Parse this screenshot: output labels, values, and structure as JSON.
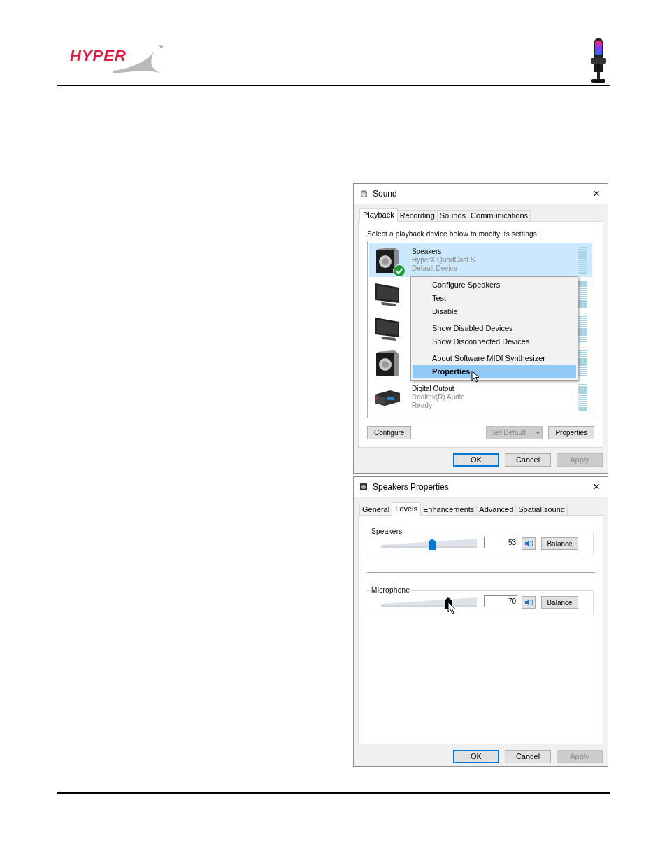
{
  "header": {
    "logo": {
      "text": "HYPER",
      "trademark": "™"
    }
  },
  "sound_window": {
    "title": "Sound",
    "close": "×",
    "tabs": [
      {
        "label": "Playback",
        "selected": true
      },
      {
        "label": "Recording",
        "selected": false
      },
      {
        "label": "Sounds",
        "selected": false
      },
      {
        "label": "Communications",
        "selected": false
      }
    ],
    "instruction": "Select a playback device below to modify its settings:",
    "devices": [
      {
        "kind": "speaker",
        "selected": true,
        "default": true,
        "name": "Speakers",
        "lines": [
          "HyperX QuadCast S",
          "Default Device"
        ]
      },
      {
        "kind": "monitor",
        "selected": false,
        "default": false
      },
      {
        "kind": "monitor",
        "selected": false,
        "default": false
      },
      {
        "kind": "speaker",
        "selected": false,
        "default": false
      },
      {
        "kind": "receiver",
        "selected": false,
        "default": false,
        "name": "Digital Output",
        "lines": [
          "Realtek(R) Audio",
          "Ready"
        ]
      }
    ],
    "context_menu": {
      "groups": [
        [
          {
            "label": "Configure Speakers",
            "selected": false
          },
          {
            "label": "Test",
            "selected": false
          },
          {
            "label": "Disable",
            "selected": false
          }
        ],
        [
          {
            "label": "Show Disabled Devices",
            "selected": false
          },
          {
            "label": "Show Disconnected Devices",
            "selected": false
          }
        ],
        [
          {
            "label": "About Software MIDI Synthesizer",
            "selected": false
          },
          {
            "label": "Properties",
            "selected": true
          }
        ]
      ]
    },
    "buttons": [
      {
        "label": "Configure",
        "kind": "plain",
        "disabled": false
      },
      {
        "label": "Set Default",
        "kind": "split",
        "disabled": true
      },
      {
        "label": "Properties",
        "kind": "plain",
        "disabled": false
      }
    ],
    "dialog_buttons": [
      {
        "label": "OK",
        "disabled": false,
        "focused": true
      },
      {
        "label": "Cancel",
        "disabled": false,
        "focused": false
      },
      {
        "label": "Apply",
        "disabled": true,
        "focused": false
      }
    ]
  },
  "properties_window": {
    "title": "Speakers Properties",
    "close": "×",
    "tabs": [
      {
        "label": "General",
        "selected": false
      },
      {
        "label": "Levels",
        "selected": true
      },
      {
        "label": "Enhancements",
        "selected": false
      },
      {
        "label": "Advanced",
        "selected": false
      },
      {
        "label": "Spatial sound",
        "selected": false
      }
    ],
    "levels": [
      {
        "label": "Speakers",
        "level": 0.53,
        "value": "53",
        "pressed": false,
        "button": "Balance"
      },
      {
        "label": "Microphone",
        "level": 0.7,
        "value": "70",
        "pressed": true,
        "button": "Balance"
      }
    ],
    "dialog_buttons": [
      {
        "label": "OK",
        "disabled": false,
        "focused": true
      },
      {
        "label": "Cancel",
        "disabled": false,
        "focused": false
      },
      {
        "label": "Apply",
        "disabled": true,
        "focused": false
      }
    ]
  }
}
